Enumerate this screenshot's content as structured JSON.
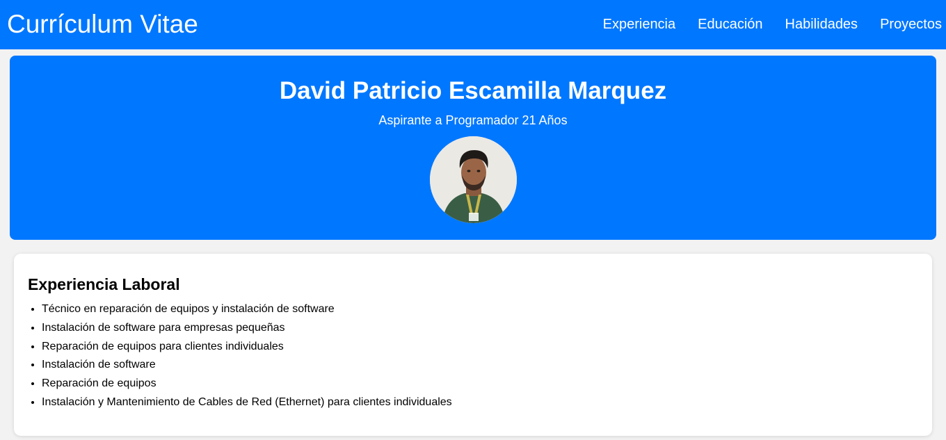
{
  "header": {
    "title": "Currículum Vitae",
    "nav": [
      "Experiencia",
      "Educación",
      "Habilidades",
      "Proyectos"
    ]
  },
  "profile": {
    "name": "David Patricio Escamilla Marquez",
    "subtitle": "Aspirante a Programador 21 Años"
  },
  "experience": {
    "heading": "Experiencia Laboral",
    "items": [
      "Técnico en reparación de equipos y instalación de software",
      "Instalación de software para empresas pequeñas",
      "Reparación de equipos para clientes individuales",
      "Instalación de software",
      "Reparación de equipos",
      "Instalación y Mantenimiento de Cables de Red (Ethernet) para clientes individuales"
    ]
  },
  "colors": {
    "primary": "#0077ff",
    "background": "#f2f2f2",
    "card": "#ffffff"
  }
}
